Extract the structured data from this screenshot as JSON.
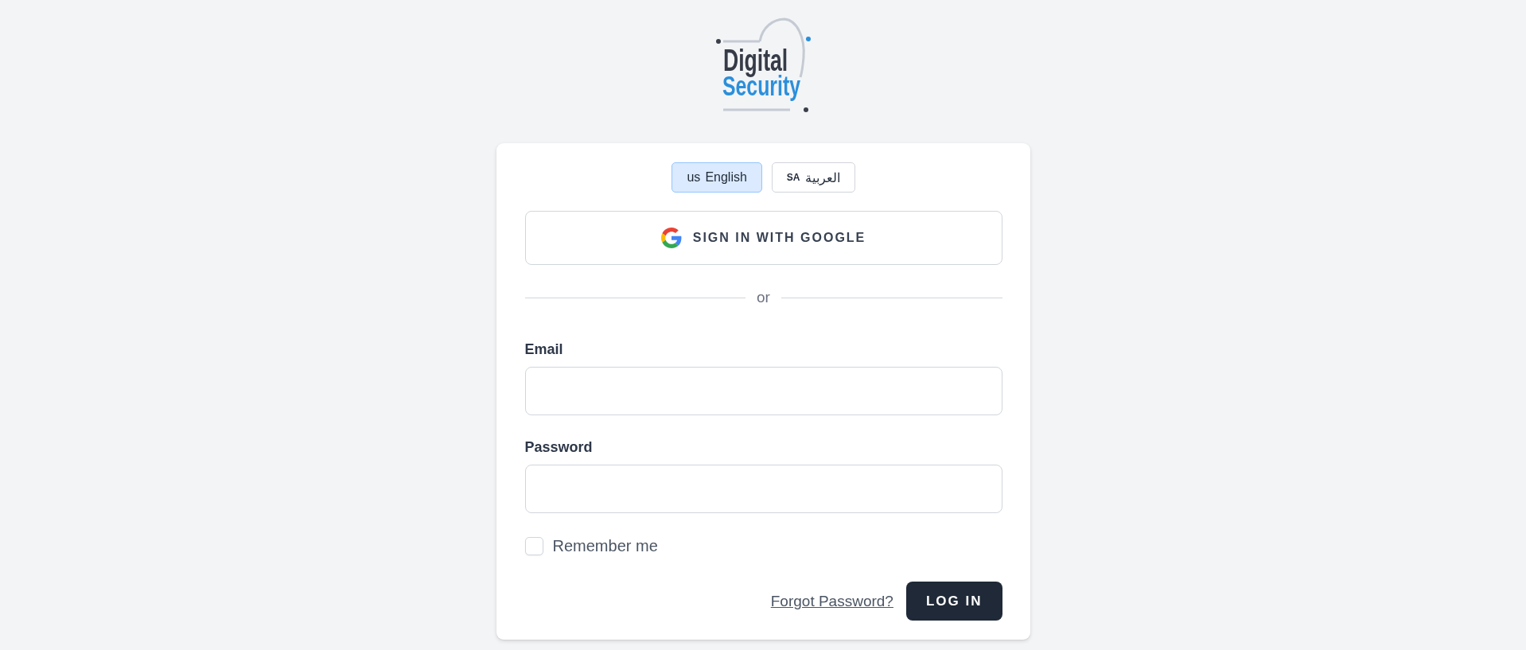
{
  "logo": {
    "line_1": "Digital",
    "line_2": "Security"
  },
  "language_switcher": [
    {
      "flag": "us",
      "label": "English",
      "selected": true
    },
    {
      "flag": "SA",
      "label": "العربية",
      "selected": false
    }
  ],
  "google_button": {
    "label": "SIGN IN WITH GOOGLE"
  },
  "divider": {
    "label": "or"
  },
  "fields": [
    {
      "label": "Email"
    },
    {
      "label": "Password"
    }
  ],
  "remember_me": {
    "label": "Remember me",
    "checked": false
  },
  "forgot_password": {
    "label": "Forgot Password?"
  },
  "login_button": {
    "label": "LOG IN"
  }
}
